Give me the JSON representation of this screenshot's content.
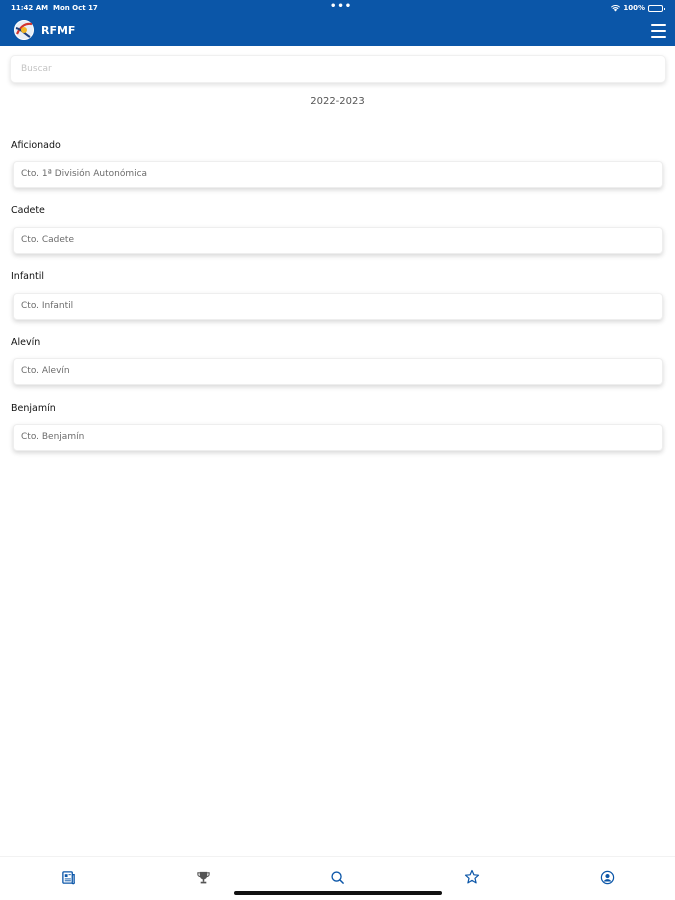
{
  "status_bar": {
    "time": "11:42 AM",
    "date": "Mon Oct 17",
    "dots": "•••",
    "battery": "100%"
  },
  "app": {
    "title": "RFMF",
    "accent": "#0b56a8"
  },
  "search": {
    "placeholder": "Buscar"
  },
  "season": "2022-2023",
  "sections": [
    {
      "label": "Aficionado",
      "item": "Cto. 1ª División Autonómica"
    },
    {
      "label": "Cadete",
      "item": "Cto. Cadete"
    },
    {
      "label": "Infantil",
      "item": "Cto. Infantil"
    },
    {
      "label": "Alevín",
      "item": "Cto. Alevín"
    },
    {
      "label": "Benjamín",
      "item": "Cto. Benjamín"
    }
  ],
  "tabs": [
    {
      "icon": "news-icon"
    },
    {
      "icon": "trophy-icon"
    },
    {
      "icon": "search-icon"
    },
    {
      "icon": "star-icon"
    },
    {
      "icon": "user-icon"
    }
  ]
}
